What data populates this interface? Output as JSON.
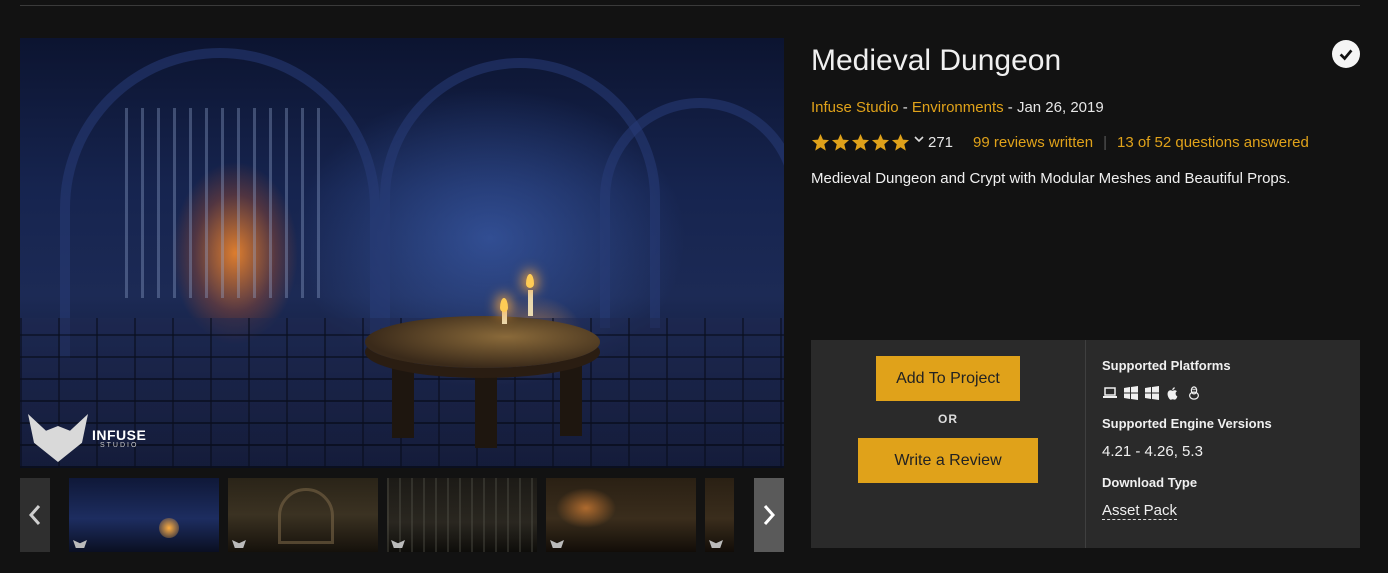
{
  "product": {
    "title": "Medieval Dungeon",
    "publisher": "Infuse Studio",
    "separator1": " - ",
    "category": "Environments",
    "date_text": " - Jan 26, 2019",
    "rating_count": "271",
    "reviews_link": "99 reviews written",
    "questions_link": "13 of 52 questions answered",
    "description": "Medieval Dungeon and Crypt with Modular Meshes and Beautiful Props.",
    "stars": 5,
    "owned_icon": "check-circle-icon"
  },
  "hero": {
    "logo_text": "INFUSE",
    "logo_sub": "STUDIO"
  },
  "gallery": {
    "prev_icon": "chevron-left-icon",
    "next_icon": "chevron-right-icon",
    "thumbnail_count": 5
  },
  "actions": {
    "add_to_project": "Add To Project",
    "or_text": "OR",
    "write_review": "Write a Review"
  },
  "details": {
    "platforms_heading": "Supported Platforms",
    "platform_icons": [
      "laptop-icon",
      "windows-icon",
      "windows-icon",
      "apple-icon",
      "linux-icon"
    ],
    "engine_heading": "Supported Engine Versions",
    "engine_versions": "4.21 - 4.26, 5.3",
    "download_heading": "Download Type",
    "download_type": "Asset Pack"
  },
  "colors": {
    "accent": "#e0a21a",
    "background": "#121212",
    "panel": "#2a2a2a"
  }
}
